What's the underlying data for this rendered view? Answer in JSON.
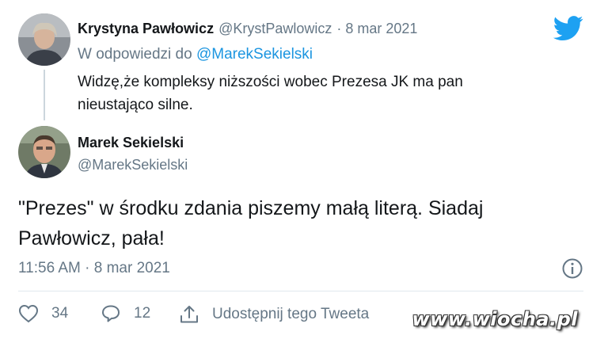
{
  "reply_tweet": {
    "author_name": "Krystyna Pawłowicz",
    "author_handle": "@KrystPawlowicz",
    "date": "· 8 mar 2021",
    "in_reply_prefix": "W odpowiedzi do",
    "in_reply_handle": "@MarekSekielski",
    "text": "Widzę,że kompleksy niższości wobec Prezesa JK ma pan nieustająco silne."
  },
  "main_tweet": {
    "author_name": "Marek Sekielski",
    "author_handle": "@MarekSekielski",
    "text": "\"Prezes\" w środku zdania piszemy małą literą. Siadaj Pawłowicz, pała!",
    "timestamp": "11:56 AM · 8 mar 2021"
  },
  "actions": {
    "likes": "34",
    "replies": "12",
    "share_label": "Udostępnij tego Tweeta"
  },
  "watermark": "www.wiocha.pl",
  "icons": {
    "brand": "twitter-bird-icon",
    "info": "info-icon",
    "like": "heart-icon",
    "reply": "reply-bubble-icon",
    "share": "share-icon"
  },
  "colors": {
    "twitter_blue": "#1da1f2",
    "link": "#1b95e0",
    "muted": "#657786"
  }
}
